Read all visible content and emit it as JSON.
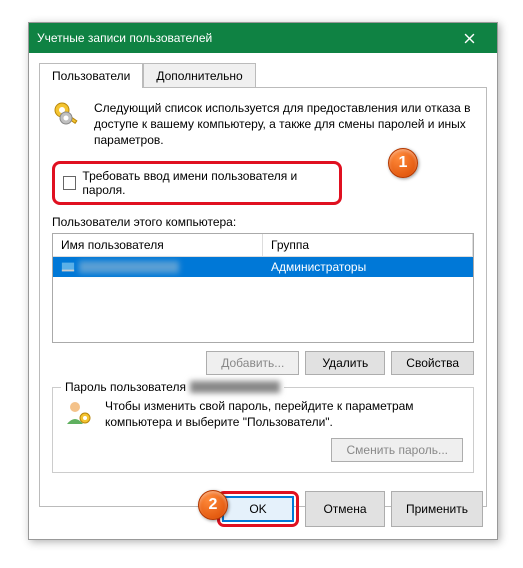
{
  "window": {
    "title": "Учетные записи пользователей"
  },
  "tabs": {
    "users": "Пользователи",
    "advanced": "Дополнительно"
  },
  "description": "Следующий список используется для предоставления или отказа в доступе к вашему компьютеру, а также для смены паролей и иных параметров.",
  "checkbox": {
    "label": "Требовать ввод имени пользователя и пароля."
  },
  "list": {
    "label": "Пользователи этого компьютера:",
    "columns": {
      "name": "Имя пользователя",
      "group": "Группа"
    },
    "rows": [
      {
        "group": "Администраторы"
      }
    ]
  },
  "buttons": {
    "add": "Добавить...",
    "remove": "Удалить",
    "properties": "Свойства",
    "changepwd": "Сменить пароль...",
    "ok": "OK",
    "cancel": "Отмена",
    "apply": "Применить"
  },
  "password_section": {
    "legend_prefix": "Пароль пользователя",
    "text": "Чтобы изменить свой пароль, перейдите к параметрам компьютера и выберите \"Пользователи\"."
  },
  "callouts": {
    "one": "1",
    "two": "2"
  }
}
